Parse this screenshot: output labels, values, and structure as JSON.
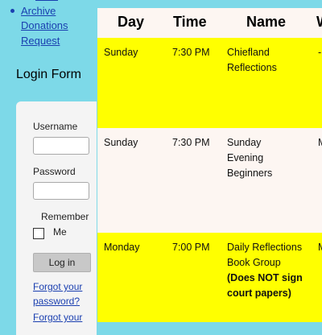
{
  "sidebar": {
    "links": [
      "Archive",
      "Donations",
      "Request"
    ]
  },
  "login": {
    "title": "Login Form",
    "username_label": "Username",
    "username_value": "",
    "password_label": "Password",
    "password_value": "",
    "remember_label_1": "Remember",
    "remember_label_2": "Me",
    "remember_checked": false,
    "login_button": "Log in",
    "forgot_password": "Forgot your password?",
    "forgot_username": "Forgot your"
  },
  "table": {
    "headers": [
      "Day",
      "Time",
      "Name",
      "W"
    ],
    "rows": [
      {
        "day": "Sunday",
        "time": "7:30 PM",
        "name": "Chiefland Reflections",
        "note": "",
        "highlight": true
      },
      {
        "day": "Sunday",
        "time": "7:30 PM",
        "name": "Sunday Evening Beginners",
        "note": "",
        "highlight": false
      },
      {
        "day": "Monday",
        "time": "7:00 PM",
        "name": "Daily Reflections Book Group",
        "note": "(Does NOT sign court papers)",
        "highlight": true
      }
    ],
    "colors": {
      "highlight": "#ffff00",
      "plain": "#fdf6f2",
      "page_bg": "#7dd9e8",
      "link": "#1a3fb0"
    }
  }
}
